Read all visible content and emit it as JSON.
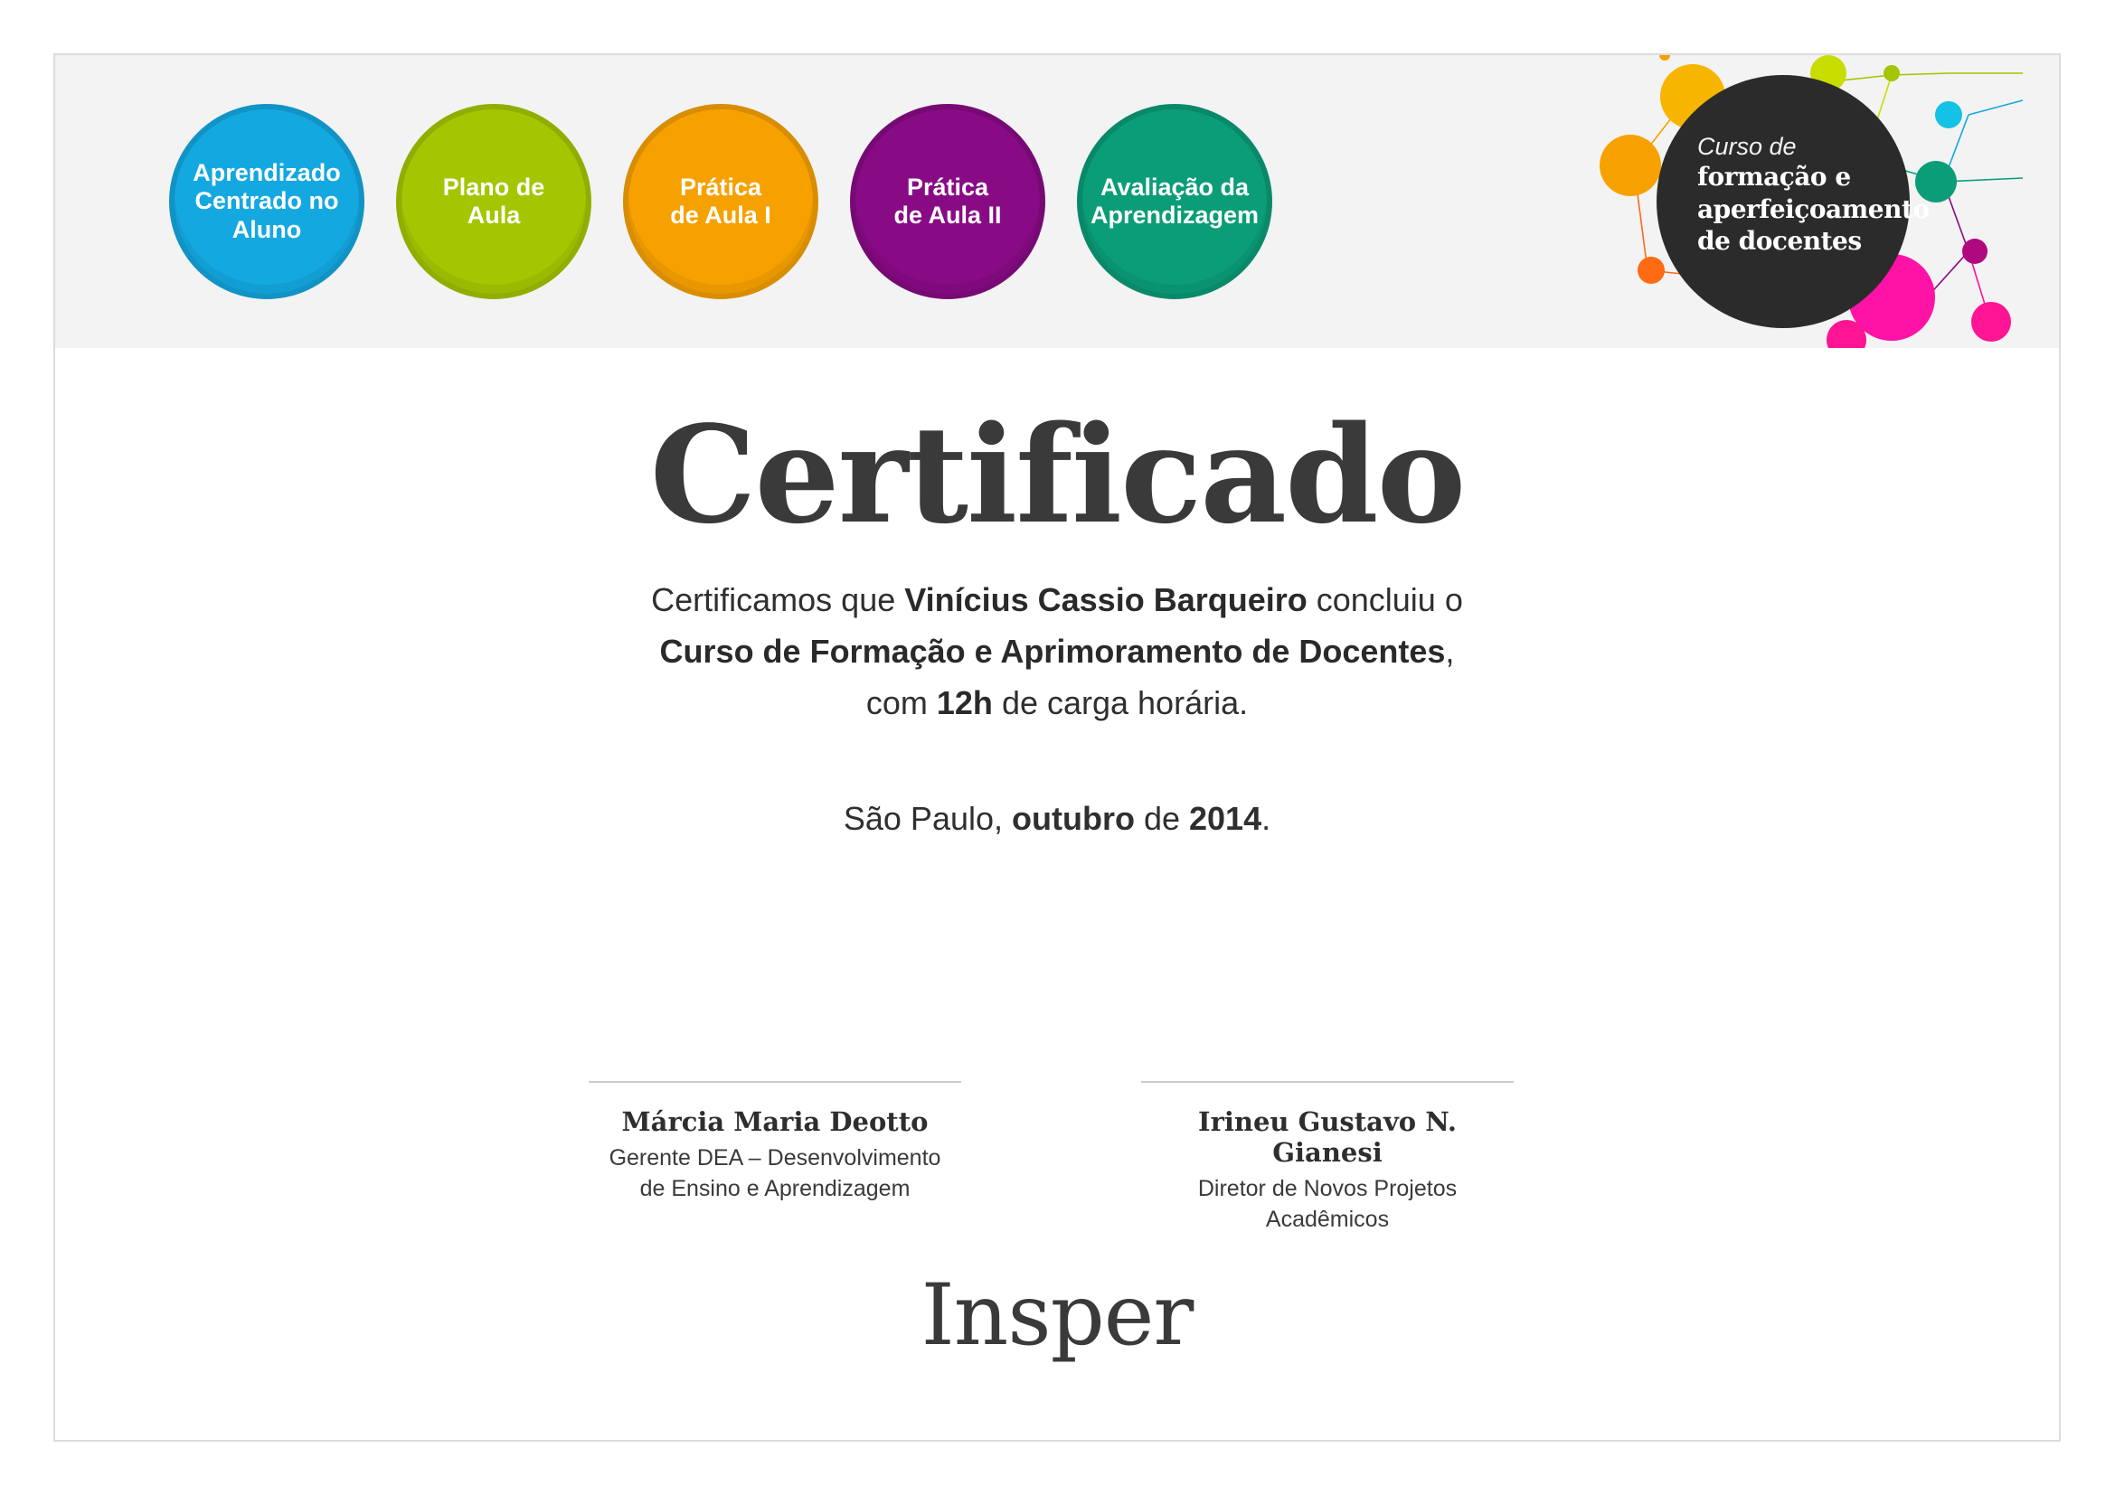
{
  "modules": [
    {
      "label": "Aprendizado\nCentrado no\nAluno",
      "color": "#14a8e1"
    },
    {
      "label": "Plano de Aula",
      "color": "#a3c600"
    },
    {
      "label": "Prática\nde Aula I",
      "color": "#f7a100"
    },
    {
      "label": "Prática\nde Aula II",
      "color": "#880b85"
    },
    {
      "label": "Avaliação da\nAprendizagem",
      "color": "#0b9d78"
    }
  ],
  "course_badge": {
    "pre": "Curso de",
    "main": "formação e\naperfeiçoamento\nde docentes",
    "color": "#2b2b2b"
  },
  "certificate": {
    "title": "Certificado",
    "line1_pre": "Certificamos que ",
    "recipient": "Vinícius Cassio Barqueiro",
    "line1_post": " concluiu o",
    "course_name": "Curso de Formação e Aprimoramento de Docentes",
    "line2_post": ",",
    "line3_pre": "com ",
    "hours": "12h",
    "line3_post": " de carga horária.",
    "place": "São Paulo, ",
    "month": "outubro",
    "date_mid": " de ",
    "year": "2014",
    "date_end": "."
  },
  "signatures": [
    {
      "name": "Márcia Maria Deotto",
      "role": "Gerente DEA – Desenvolvimento\nde Ensino e Aprendizagem"
    },
    {
      "name": "Irineu Gustavo N. Gianesi",
      "role": "Diretor de Novos Projetos Acadêmicos"
    }
  ],
  "logo": {
    "text": "Insper"
  }
}
